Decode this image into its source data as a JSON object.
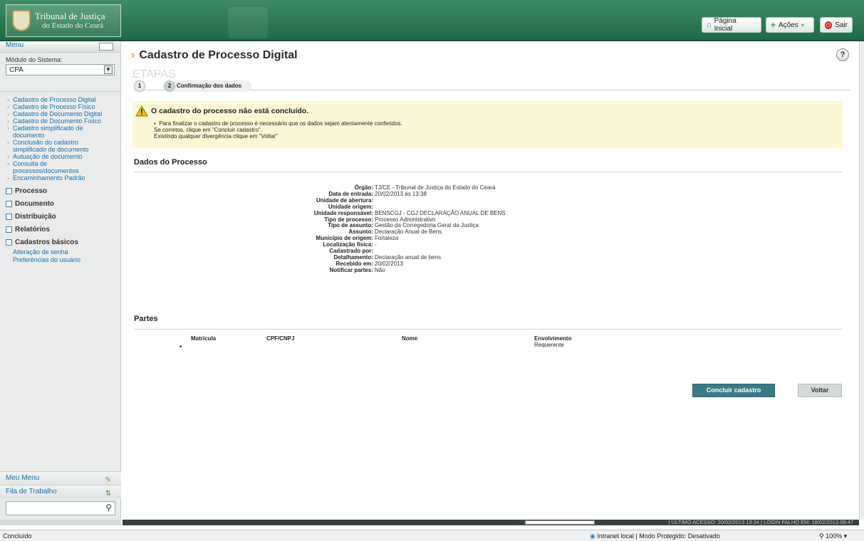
{
  "header": {
    "logo_line1": "Tribunal de Justiça",
    "logo_line2": "do Estado do Ceará",
    "btn_home": "Página Inicial",
    "btn_actions": "Ações",
    "btn_exit": "Sair"
  },
  "sidebar": {
    "menu_label": "Menu",
    "module_label": "Módulo do Sistema:",
    "module_value": "CPA",
    "links": [
      "Cadastro de Processo Digital",
      "Cadastro de Processo Físico",
      "Cadastro de Documento Digital",
      "Cadastro de Documento Físico",
      "Cadastro simplificado de documento",
      "Conclusão do cadastro simplificado de documento",
      "Autuação de documento",
      "Consulta de processos/documentos",
      "Encaminhamento Padrão"
    ],
    "groups": [
      "Processo",
      "Documento",
      "Distribuição",
      "Relatórios",
      "Cadastros básicos"
    ],
    "extra_links": [
      "Alteração de senha",
      "Preferências do usuário"
    ],
    "my_menu": "Meu Menu",
    "work_queue": "Fila de Trabalho"
  },
  "main": {
    "title": "Cadastro de Processo Digital",
    "help": "?",
    "etapas": "ETAPAS",
    "step1": "1",
    "step2": "2",
    "step2_label": "Confirmação dos dados",
    "warning_title": "O cadastro do processo não está concluído.",
    "warning_line1": "Para finalizar o cadastro de processo é necessário que os dados sejam atentamente conferidos.",
    "warning_line2": "Se corretos, clique em \"Concluir cadastro\".",
    "warning_line3": "Existindo qualquer divergência clique em \"Voltar\"",
    "section_dados": "Dados do Processo",
    "fields": [
      {
        "label": "Órgão:",
        "value": "TJ/CE - Tribunal de Justiça do Estado do Ceará"
      },
      {
        "label": "Data de entrada:",
        "value": "20/02/2013 às 13:38"
      },
      {
        "label": "Unidade de abertura:",
        "value": ""
      },
      {
        "label": "Unidade origem:",
        "value": ""
      },
      {
        "label": "Unidade responsável:",
        "value": "BENSCGJ - CGJ DECLARAÇÃO ANUAL DE BENS"
      },
      {
        "label": "Tipo de processo:",
        "value": "Processo Administrativo"
      },
      {
        "label": "Tipo de assunto:",
        "value": "Gestão da Corregedoria Geral da Justiça"
      },
      {
        "label": "Assunto:",
        "value": "Declaração Anual de Bens"
      },
      {
        "label": "Município de origem:",
        "value": "Fortaleza"
      },
      {
        "label": "Localização física:",
        "value": "-"
      },
      {
        "label": "Cadastrado por:",
        "value": ""
      },
      {
        "label": "Detalhamento:",
        "value": "Declaração anual de bens"
      },
      {
        "label": "Recebido em:",
        "value": "20/02/2013"
      },
      {
        "label": "Notificar partes:",
        "value": "Não"
      }
    ],
    "section_partes": "Partes",
    "partes_headers": [
      "Matrícula",
      "CPF/CNPJ",
      "Nome",
      "Envolvimento"
    ],
    "partes_rows": [
      {
        "matricula": "",
        "cpf": "",
        "nome": "",
        "envolvimento": "Requerente"
      }
    ],
    "btn_conclude": "Concluir cadastro",
    "btn_back": "Voltar"
  },
  "infobar": {
    "text": "|  ÚLTIMO ACESSO: 20/02/2013 13:34  |  LOGIN FALHO EM: 18/02/2013 09:47"
  },
  "statusbar": {
    "status": "Concluído",
    "zone": "Intranet local | Modo Protegido: Desativado",
    "zoom": "100%"
  }
}
